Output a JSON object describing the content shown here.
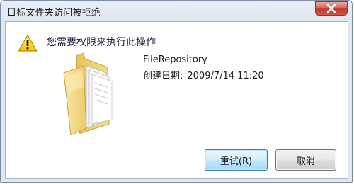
{
  "window": {
    "title": "目标文件夹访问被拒绝"
  },
  "dialog": {
    "message": "您需要权限来执行此操作",
    "warning_icon": "warning-triangle-icon",
    "item_icon": "folder-icon",
    "file_name": "FileRepository",
    "date_label": "创建日期:",
    "date_value": "2009/7/14 11:20"
  },
  "buttons": {
    "retry": "重试(R)",
    "cancel": "取消"
  },
  "colors": {
    "close_button": "#c3392c",
    "default_button_border": "#3c7fb1",
    "folder": "#f2d479"
  }
}
